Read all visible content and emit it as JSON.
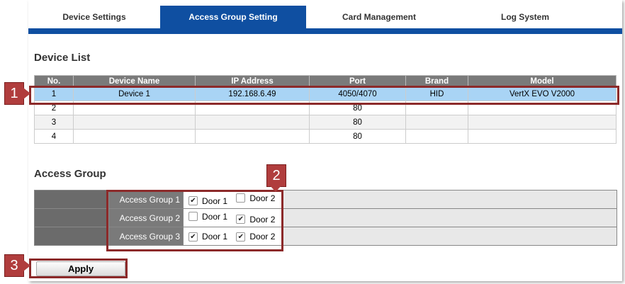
{
  "tabs": [
    {
      "label": "Device Settings",
      "active": false
    },
    {
      "label": "Access Group Setting",
      "active": true
    },
    {
      "label": "Card Management",
      "active": false
    },
    {
      "label": "Log System",
      "active": false
    }
  ],
  "device_list": {
    "title": "Device List",
    "columns": [
      "No.",
      "Device Name",
      "IP Address",
      "Port",
      "Brand",
      "Model"
    ],
    "rows": [
      [
        "1",
        "Device 1",
        "192.168.6.49",
        "4050/4070",
        "HID",
        "VertX EVO V2000"
      ],
      [
        "2",
        "",
        "",
        "80",
        "",
        ""
      ],
      [
        "3",
        "",
        "",
        "80",
        "",
        ""
      ],
      [
        "4",
        "",
        "",
        "80",
        "",
        ""
      ]
    ]
  },
  "access_group": {
    "title": "Access Group",
    "groups": [
      {
        "label": "Access Group 1",
        "door1_label": "Door 1",
        "door1_checked": true,
        "door2_label": "Door 2",
        "door2_checked": false
      },
      {
        "label": "Access Group 2",
        "door1_label": "Door 1",
        "door1_checked": false,
        "door2_label": "Door 2",
        "door2_checked": true
      },
      {
        "label": "Access Group 3",
        "door1_label": "Door 1",
        "door1_checked": true,
        "door2_label": "Door 2",
        "door2_checked": true
      }
    ]
  },
  "apply_label": "Apply",
  "annotations": [
    "1",
    "2",
    "3"
  ],
  "colors": {
    "accent": "#0f4fa1",
    "selected_row": "#a9d4f5",
    "annotation": "#b03d3d"
  }
}
